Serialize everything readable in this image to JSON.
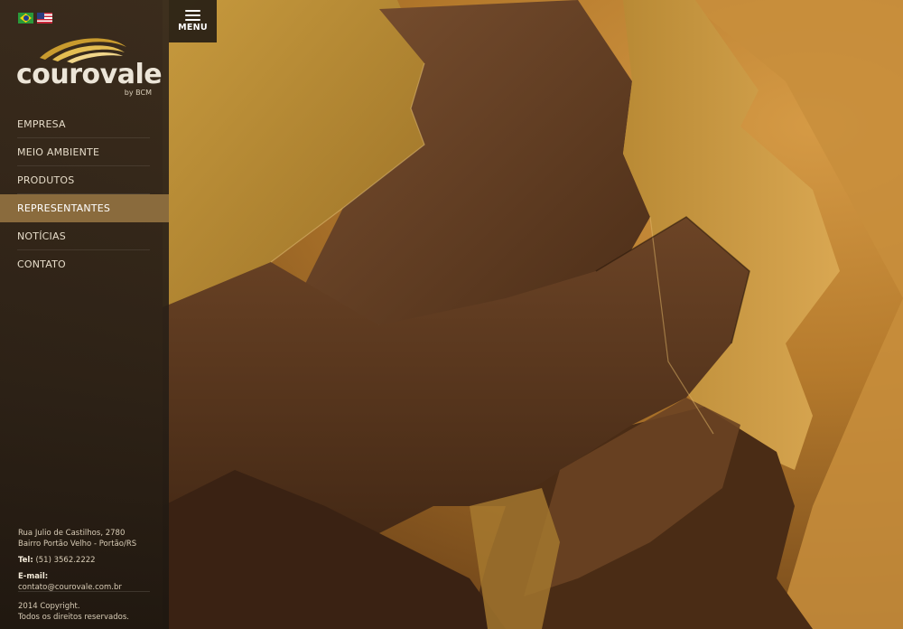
{
  "brand": {
    "name": "courovale",
    "tagline": "by BCM"
  },
  "languages": [
    {
      "code": "pt-BR",
      "icon": "flag-brazil-icon"
    },
    {
      "code": "en-US",
      "icon": "flag-usa-icon"
    }
  ],
  "menu_toggle": {
    "label": "MENU",
    "icon": "hamburger-icon"
  },
  "nav": {
    "items": [
      {
        "label": "EMPRESA",
        "active": false
      },
      {
        "label": "MEIO AMBIENTE",
        "active": false
      },
      {
        "label": "PRODUTOS",
        "active": false
      },
      {
        "label": "REPRESENTANTES",
        "active": true
      },
      {
        "label": "NOTÍCIAS",
        "active": false
      },
      {
        "label": "CONTATO",
        "active": false
      }
    ]
  },
  "contact": {
    "address_line1": "Rua Julio de Castilhos, 2780",
    "address_line2": "Bairro Portão Velho - Portão/RS",
    "phone_label": "Tel:",
    "phone": "(51) 3562.2222",
    "email_label": "E-mail:",
    "email": "contato@courovale.com.br"
  },
  "footer": {
    "copyright_line1": "2014 Copyright.",
    "copyright_line2": "Todos os direitos reservados."
  },
  "colors": {
    "active_nav": "#8a6b3d",
    "logo_gold": "#c79a2c",
    "sidebar": "#2f241a"
  }
}
